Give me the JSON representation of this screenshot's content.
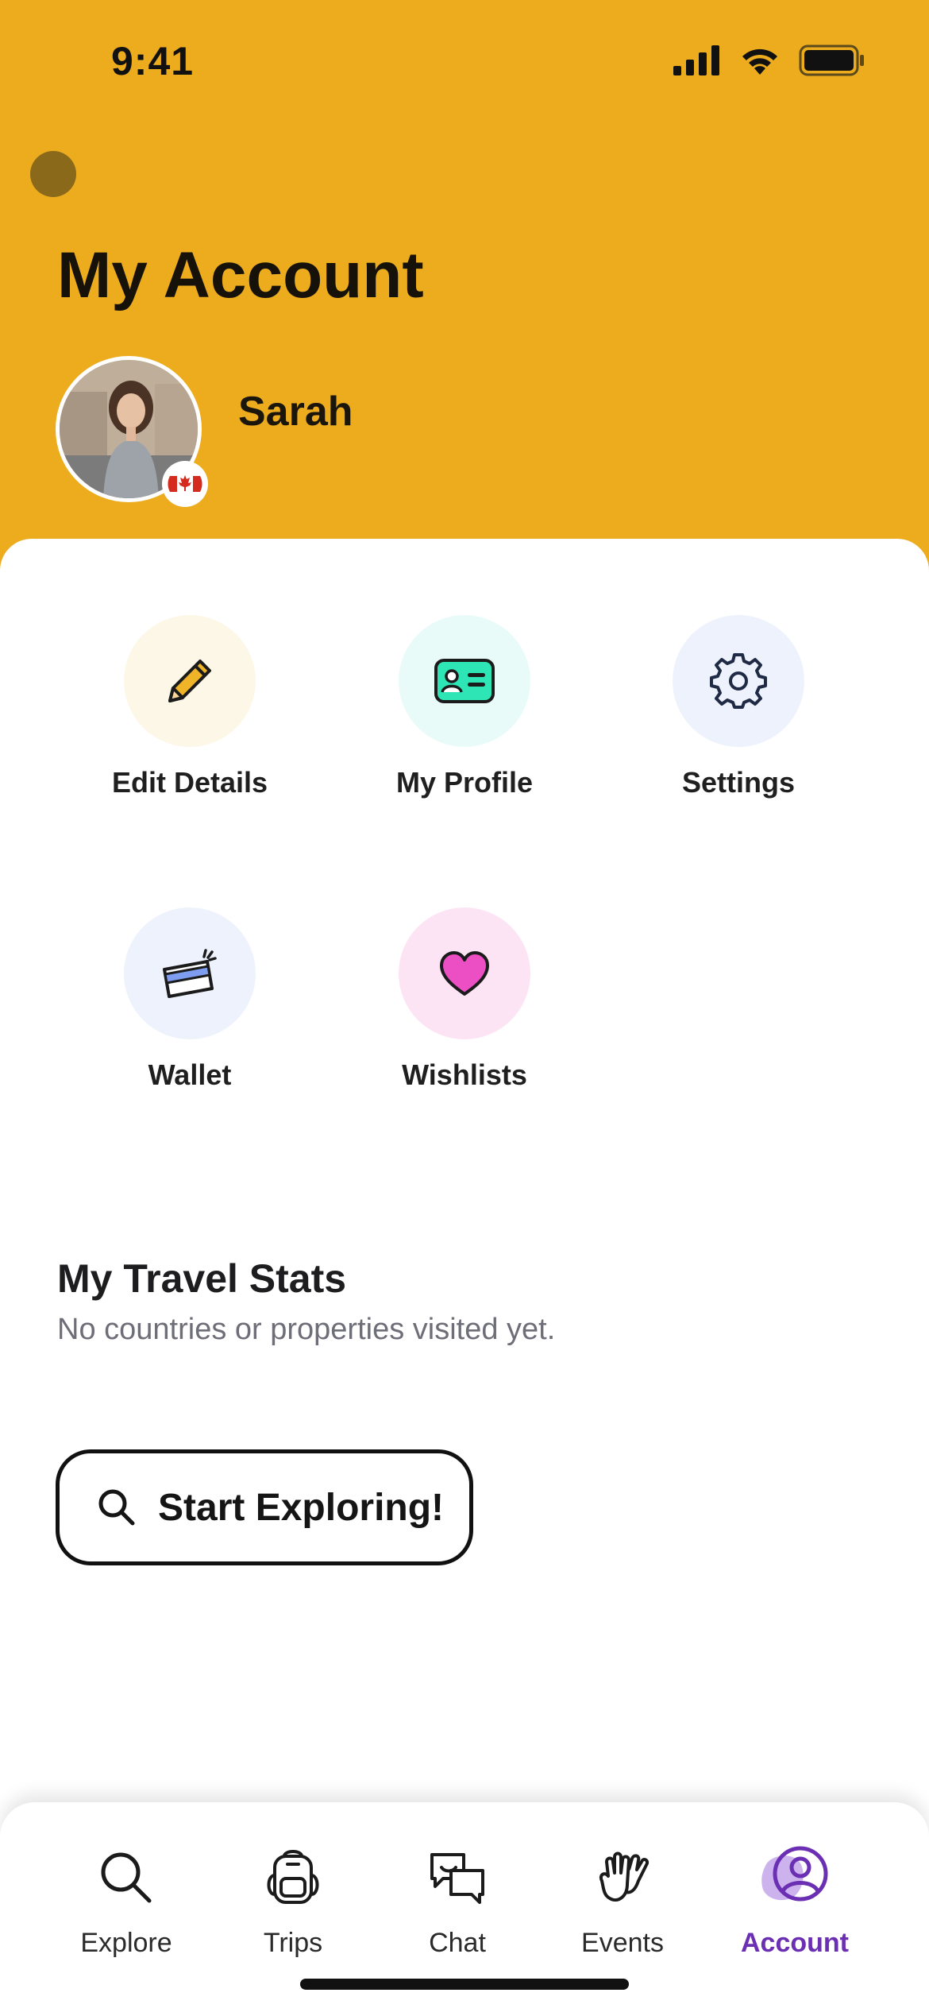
{
  "status_bar": {
    "time": "9:41"
  },
  "header": {
    "title": "My Account",
    "user_name": "Sarah"
  },
  "actions": [
    {
      "label": "Edit Details",
      "icon": "pencil-icon"
    },
    {
      "label": "My Profile",
      "icon": "id-card-icon"
    },
    {
      "label": "Settings",
      "icon": "gear-icon"
    },
    {
      "label": "Wallet",
      "icon": "wallet-card-icon"
    },
    {
      "label": "Wishlists",
      "icon": "heart-icon"
    }
  ],
  "stats": {
    "title": "My Travel Stats",
    "subtitle": "No countries or properties visited yet."
  },
  "cta": {
    "label": "Start Exploring!"
  },
  "tabbar": {
    "active": "Account",
    "items": [
      {
        "label": "Explore",
        "icon": "search-icon"
      },
      {
        "label": "Trips",
        "icon": "backpack-icon"
      },
      {
        "label": "Chat",
        "icon": "chat-bubbles-icon"
      },
      {
        "label": "Events",
        "icon": "waving-hands-icon"
      },
      {
        "label": "Account",
        "icon": "user-circle-icon"
      }
    ]
  },
  "colors": {
    "header_bg": "#ECAC1E",
    "active_tab": "#6B2FB3",
    "pencil": "#F0B429",
    "id_card": "#2EE6B5",
    "wallet_card": "#7E9CF0",
    "heart": "#EC4FC3"
  }
}
